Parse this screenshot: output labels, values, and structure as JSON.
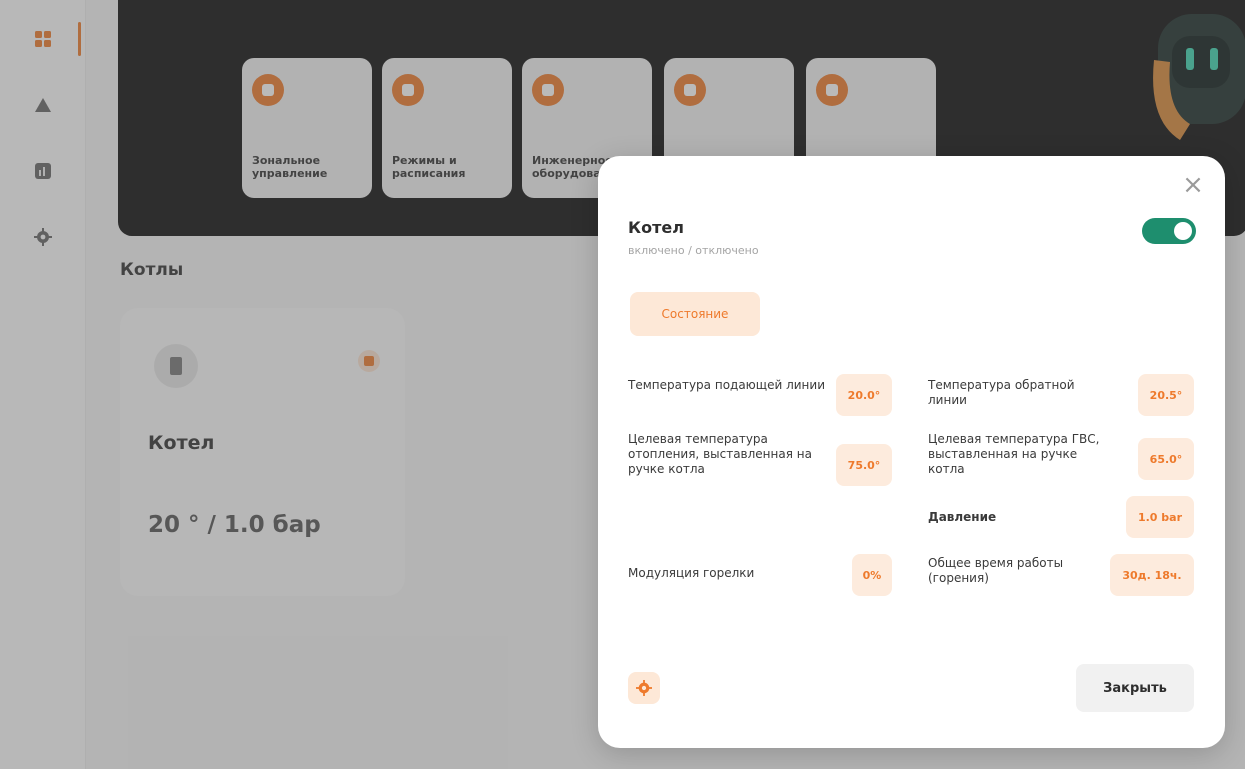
{
  "hero": {
    "subtitle": "",
    "tiles": [
      {
        "label": "Зональное управление"
      },
      {
        "label": "Режимы и расписания"
      },
      {
        "label": "Инженерное оборудование"
      },
      {
        "label": ""
      },
      {
        "label": ""
      }
    ]
  },
  "boilers": {
    "section_title": "Котлы",
    "card": {
      "type_label": "",
      "name": "Котел",
      "status": "",
      "reading_label": "",
      "value": "20 ° / 1.0 бар",
      "footer": ""
    }
  },
  "modal": {
    "title": "Котел",
    "subtitle": "включено / отключено",
    "toggle_on": true,
    "tab_label": "Состояние",
    "params": {
      "supply_temp_label": "Температура подающей линии",
      "supply_temp_value": "20.0°",
      "return_temp_label": "Температура обратной линии",
      "return_temp_value": "20.5°",
      "target_heating_label": "Целевая температура отопления, выставленная на ручке котла",
      "target_heating_value": "75.0°",
      "target_dhw_label": "Целевая температура ГВС, выставленная на ручке котла",
      "target_dhw_value": "65.0°",
      "pressure_label": "Давление",
      "pressure_value": "1.0 bar",
      "modulation_label": "Модуляция горелки",
      "modulation_value": "0%",
      "runtime_label": "Общее время работы (горения)",
      "runtime_value": "30д. 18ч."
    },
    "close_label": "Закрыть"
  },
  "colors": {
    "accent": "#ee7a2c",
    "toggle": "#1e8e6e",
    "value_bg": "#fdebdd"
  }
}
